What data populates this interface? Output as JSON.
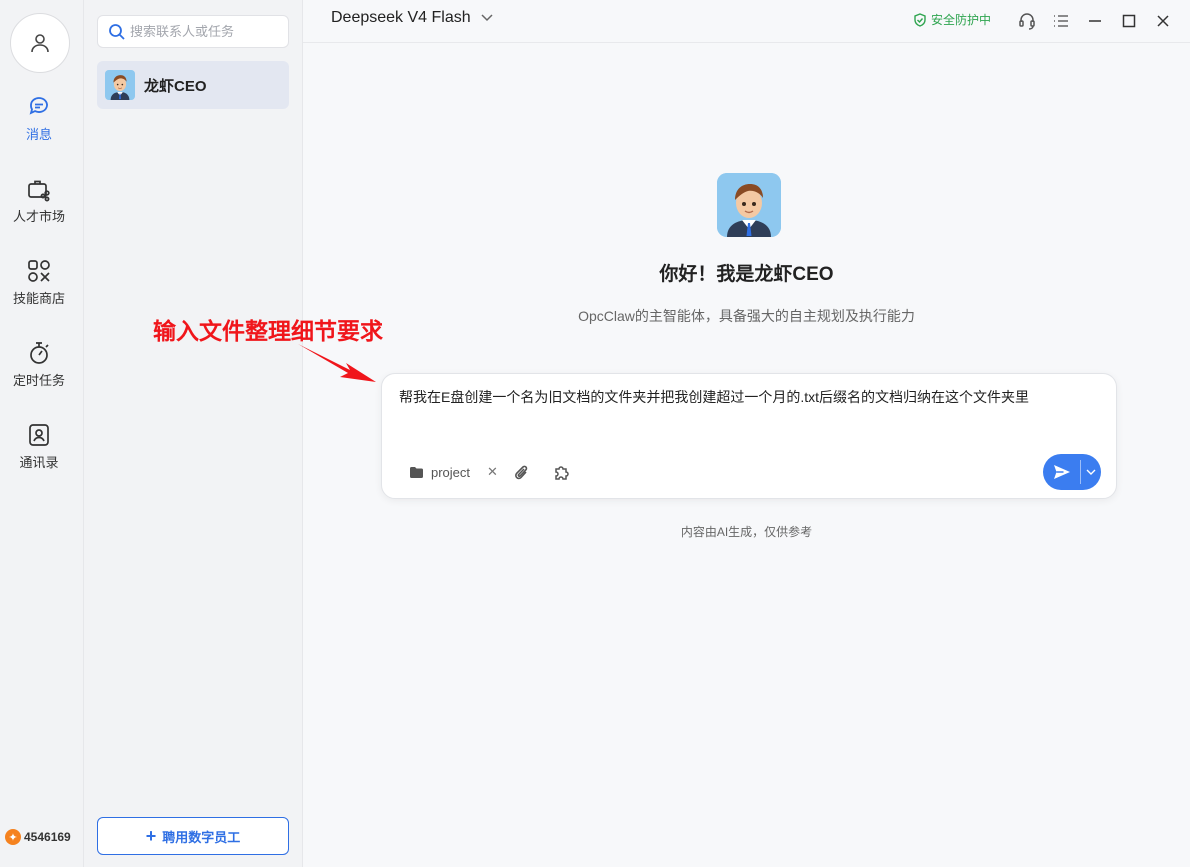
{
  "user_points": "4546169",
  "nav": {
    "messages": "消息",
    "talent": "人才市场",
    "skills": "技能商店",
    "scheduled": "定时任务",
    "contacts": "通讯录"
  },
  "contacts_panel": {
    "search_placeholder": "搜索联系人或任务",
    "contact_name": "龙虾CEO",
    "hire_button": "聘用数字员工"
  },
  "topbar": {
    "model_name": "Deepseek V4 Flash",
    "security_status": "安全防护中"
  },
  "hero": {
    "title": "你好！我是龙虾CEO",
    "subtitle": "OpcClaw的主智能体，具备强大的自主规划及执行能力"
  },
  "annotation": "输入文件整理细节要求",
  "composer": {
    "input_text": "帮我在E盘创建一个名为旧文档的文件夹并把我创建超过一个月的.txt后缀名的文档归纳在这个文件夹里",
    "folder_chip": "project"
  },
  "disclaimer": "内容由AI生成，仅供参考",
  "colors": {
    "accent": "#2f6fe4",
    "send": "#3b7df0",
    "secure": "#2ea44f",
    "annotation": "#f0161b"
  }
}
